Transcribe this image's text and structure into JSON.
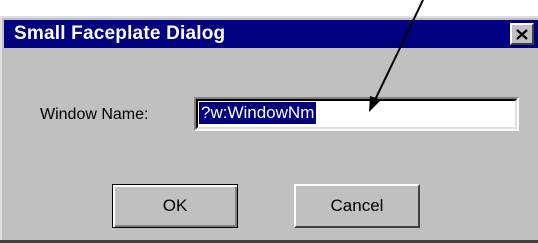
{
  "dialog": {
    "title": "Small Faceplate Dialog",
    "close_icon": "close-icon"
  },
  "form": {
    "window_name_label": "Window Name:",
    "window_name_value": "?w:WindowNm"
  },
  "buttons": {
    "ok_label": "OK",
    "cancel_label": "Cancel"
  },
  "colors": {
    "titlebar": "#000080",
    "dialog_face": "#c0c0c0",
    "selection": "#000080"
  }
}
